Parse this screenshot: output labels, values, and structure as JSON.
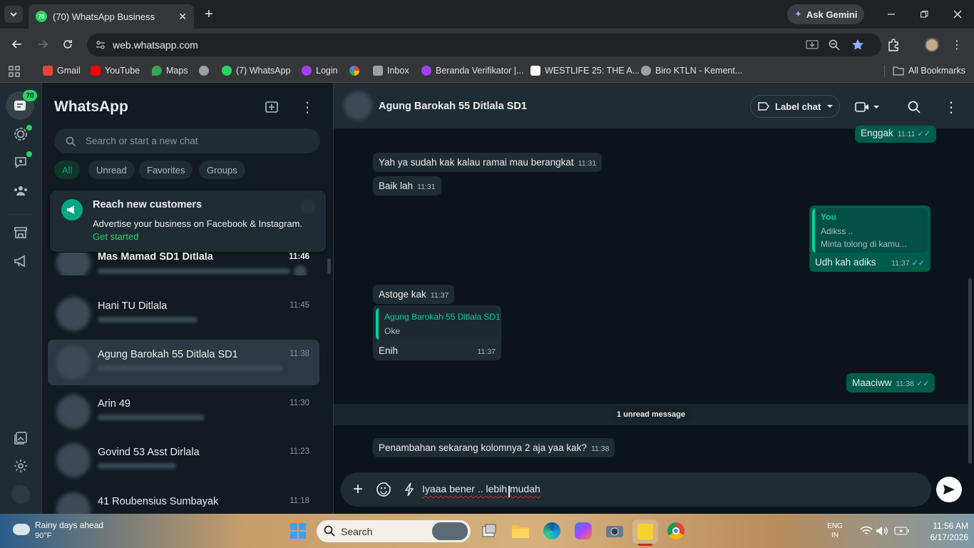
{
  "browser": {
    "tab_title": "(70) WhatsApp Business",
    "tab_badge": "70",
    "gemini_label": "Ask Gemini",
    "url": "web.whatsapp.com",
    "bookmarks": [
      {
        "label": "Gmail",
        "color": "#ea4335"
      },
      {
        "label": "YouTube",
        "color": "#ff0000"
      },
      {
        "label": "Maps",
        "color": "#34a853"
      },
      {
        "label": "",
        "color": "#9aa0a6"
      },
      {
        "label": "(7) WhatsApp",
        "color": "#25d366"
      },
      {
        "label": "Login",
        "color": "#a142f4"
      },
      {
        "label": "",
        "color": "#fbbc04"
      },
      {
        "label": "Inbox",
        "color": "#9aa0a6"
      },
      {
        "label": "Beranda Verifikator |...",
        "color": "#a142f4"
      },
      {
        "label": "WESTLIFE 25: THE A...",
        "color": "#ffffff"
      },
      {
        "label": "Biro KTLN - Kement...",
        "color": "#9aa0a6"
      }
    ],
    "all_bookmarks": "All Bookmarks"
  },
  "rail": {
    "badge": "70"
  },
  "sidebar": {
    "title": "WhatsApp",
    "search_placeholder": "Search or start a new chat",
    "filters": [
      "All",
      "Unread",
      "Favorites",
      "Groups"
    ],
    "promo": {
      "title": "Reach new customers",
      "text": "Advertise your business on Facebook & Instagram.",
      "link": "Get started"
    },
    "chats": [
      {
        "name": "Mas Mamad SD1 Ditlala",
        "time": "11:46"
      },
      {
        "name": "Hani TU Ditlala",
        "time": "11:45"
      },
      {
        "name": "Agung Barokah 55 Ditlala SD1",
        "time": "11:38"
      },
      {
        "name": "Arin 49",
        "time": "11:30"
      },
      {
        "name": "Govind 53 Asst Dirlala",
        "time": "11:23"
      },
      {
        "name": "41 Roubensius Sumbayak",
        "time": "11:18"
      }
    ]
  },
  "chat": {
    "contact": "Agung Barokah 55 Ditlala SD1",
    "label_chat": "Label chat",
    "messages": [
      {
        "text": "Enggak",
        "time": "11:11"
      },
      {
        "text": "Yah ya sudah kak kalau ramai mau berangkat",
        "time": "11:31"
      },
      {
        "text": "Baik lah",
        "time": "11:31"
      },
      {
        "quote_author": "You",
        "quote_line1": "Adikss ..",
        "quote_line2": "Minta tolong di kamu...",
        "text": "Udh kah adiks",
        "time": "11:37"
      },
      {
        "text": "Astoge kak",
        "time": "11:37"
      },
      {
        "quote_author": "Agung Barokah 55 Ditlala SD1",
        "quote_line1": "Oke",
        "text": "Enih",
        "time": "11:37"
      },
      {
        "text": "Maaciww",
        "time": "11:38"
      },
      {
        "text": "Penambahan sekarang kolomnya 2 aja yaa kak?",
        "time": "11:38"
      }
    ],
    "unread_divider": "1 unread message",
    "composer_text": "Iyaaa bener .. lebih mudah"
  },
  "taskbar": {
    "weather_title": "Rainy days ahead",
    "weather_temp": "90°F",
    "search_label": "Search",
    "lang_line1": "ENG",
    "lang_line2": "IN",
    "time": "11:56 AM",
    "date": "6/17/2026"
  }
}
